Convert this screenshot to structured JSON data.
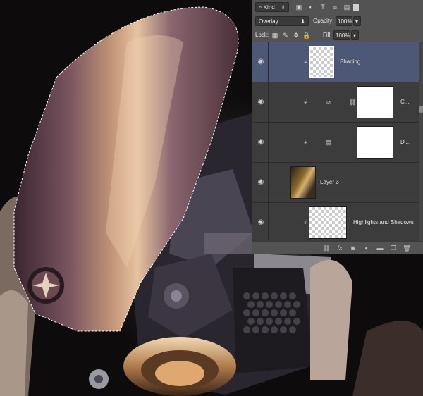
{
  "filter": {
    "kind_label": "Kind"
  },
  "blend": {
    "mode": "Overlay",
    "opacity_label": "Opacity:",
    "opacity_value": "100%"
  },
  "lock": {
    "label": "Lock:",
    "fill_label": "Fill:",
    "fill_value": "100%"
  },
  "layers": [
    {
      "name": "Shading",
      "selected": true,
      "type": "pixel",
      "clipped": true
    },
    {
      "name": "C...",
      "type": "curves-adjustment",
      "clipped": true
    },
    {
      "name": "Di...",
      "type": "adjustment",
      "clipped": true
    },
    {
      "name": "Layer 3",
      "type": "pixel",
      "clipped": false
    },
    {
      "name": "Highlights and Shadows",
      "type": "pixel",
      "clipped": true
    }
  ],
  "colors": {
    "panel_bg": "#535353",
    "row_bg": "#3c3c3c",
    "selected_row": "#4d5877"
  },
  "icons": {
    "filter_bar": [
      "search-icon",
      "pixel-filter-icon",
      "adjustment-filter-icon",
      "type-filter-icon",
      "shape-filter-icon",
      "smart-object-filter-icon",
      "filter-toggle-icon"
    ],
    "lock_bar": [
      "lock-transparent-icon",
      "lock-image-icon",
      "lock-position-icon",
      "lock-all-icon"
    ],
    "bottom_bar": [
      "link-icon",
      "fx-icon",
      "mask-icon",
      "adjustment-icon",
      "group-icon",
      "new-layer-icon",
      "trash-icon"
    ]
  }
}
